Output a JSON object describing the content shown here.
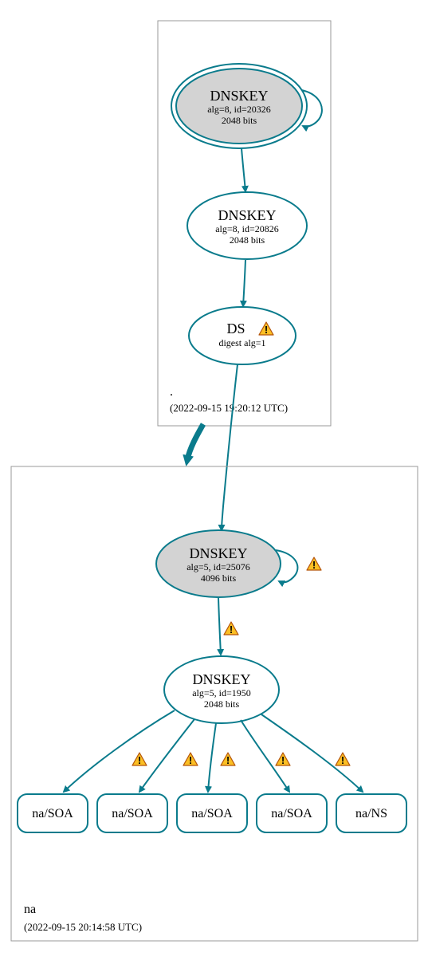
{
  "colors": {
    "stroke": "#0a7b8c",
    "greyFill": "#d3d3d3",
    "zoneBorder": "#999999",
    "warnFill": "#fbbf24",
    "warnStroke": "#b45309"
  },
  "zones": {
    "root": {
      "label": ".",
      "timestamp": "(2022-09-15 19:20:12 UTC)"
    },
    "na": {
      "label": "na",
      "timestamp": "(2022-09-15 20:14:58 UTC)"
    }
  },
  "nodes": {
    "rootKSK": {
      "line1": "DNSKEY",
      "line2": "alg=8, id=20326",
      "line3": "2048 bits"
    },
    "rootZSK": {
      "line1": "DNSKEY",
      "line2": "alg=8, id=20826",
      "line3": "2048 bits"
    },
    "ds": {
      "line1": "DS",
      "line2": "digest alg=1",
      "warn": true
    },
    "naKSK": {
      "line1": "DNSKEY",
      "line2": "alg=5, id=25076",
      "line3": "4096 bits"
    },
    "naZSK": {
      "line1": "DNSKEY",
      "line2": "alg=5, id=1950",
      "line3": "2048 bits"
    }
  },
  "leaves": {
    "l1": "na/SOA",
    "l2": "na/SOA",
    "l3": "na/SOA",
    "l4": "na/SOA",
    "l5": "na/NS"
  }
}
